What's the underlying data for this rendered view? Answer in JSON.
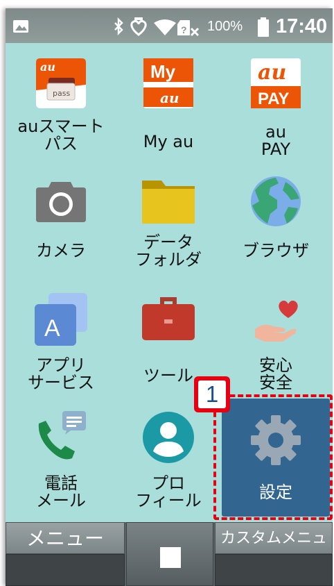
{
  "status_bar": {
    "battery_percent": "100%",
    "time": "17:40",
    "icons": [
      "image-icon",
      "bluetooth-icon",
      "heart-icon",
      "wifi-icon",
      "no-sim-icon",
      "battery-icon"
    ]
  },
  "apps": [
    {
      "label": "auスマート\nパス",
      "icon": "au-smart-pass-icon"
    },
    {
      "label": "My au",
      "icon": "my-au-icon"
    },
    {
      "label": "au\nPAY",
      "icon": "au-pay-icon"
    },
    {
      "label": "カメラ",
      "icon": "camera-icon"
    },
    {
      "label": "データ\nフォルダ",
      "icon": "folder-icon"
    },
    {
      "label": "ブラウザ",
      "icon": "globe-icon"
    },
    {
      "label": "アプリ\nサービス",
      "icon": "app-services-icon"
    },
    {
      "label": "ツール",
      "icon": "toolbox-icon"
    },
    {
      "label": "安心\n安全",
      "icon": "heart-hand-icon"
    },
    {
      "label": "電話\nメール",
      "icon": "phone-mail-icon"
    },
    {
      "label": "プロ\nフィール",
      "icon": "profile-icon"
    },
    {
      "label": "設定",
      "icon": "gear-icon"
    }
  ],
  "icon_text": {
    "smartpass_au": "au",
    "smartpass_pass": "pass",
    "myau_my": "My",
    "myau_au": "au",
    "aupay_au": "au",
    "aupay_pay": "PAY",
    "app_services_letter": "A"
  },
  "annotation": {
    "step_number": "1"
  },
  "bottom_bar": {
    "left_label": "メニュー",
    "right_label": "カスタムメニュー"
  },
  "colors": {
    "background": "#a9deda",
    "settings_tile": "#336591",
    "highlight": "#e60012",
    "au_orange": "#eb5505"
  }
}
